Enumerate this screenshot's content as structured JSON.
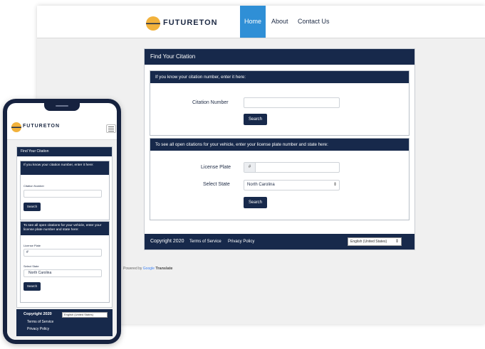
{
  "brand": {
    "name": "FUTURETON"
  },
  "nav": {
    "home": "Home",
    "about": "About",
    "contact": "Contact Us"
  },
  "card": {
    "title": "Find Your Citation",
    "section1": {
      "heading": "If you know your citation number, enter it here:",
      "citation_label": "Citation Number",
      "citation_value": "",
      "search_label": "Search"
    },
    "section2": {
      "heading": "To see all open citations for your vehicle, enter your license plate number and state here:",
      "plate_label": "License Plate",
      "plate_prefix": "#",
      "plate_value": "",
      "state_label": "Select State",
      "state_value": "North Carolina",
      "search_label": "Search"
    }
  },
  "footer": {
    "copyright": "Copyright 2020",
    "terms": "Terms of Service",
    "privacy": "Privacy Policy",
    "language": "English (United States)"
  },
  "powered": {
    "prefix": "Powered by",
    "google": "Google",
    "translate": "Translate"
  },
  "mobile": {
    "section1_heading": "If you know your citation number, enter it here:",
    "section2_heading": "To see all open citations for your vehicle, enter your license plate number and state here:"
  },
  "colors": {
    "navy": "#17294b",
    "accent": "#2f8fd6",
    "logo_gold": "#f2b23c"
  }
}
